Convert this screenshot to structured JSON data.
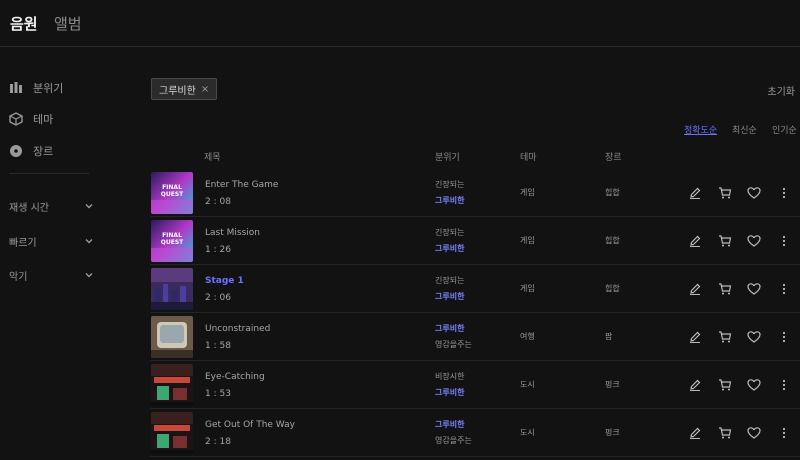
{
  "tabs": [
    {
      "label": "음원",
      "active": true
    },
    {
      "label": "앨범",
      "active": false
    }
  ],
  "sidebar": {
    "filters": [
      {
        "label": "분위기",
        "icon": "bars-icon"
      },
      {
        "label": "테마",
        "icon": "cube-icon"
      },
      {
        "label": "장르",
        "icon": "disc-icon"
      }
    ],
    "collapsibles": [
      {
        "label": "재생 시간",
        "icon": "chevron-down-icon"
      },
      {
        "label": "빠르기",
        "icon": "chevron-down-icon"
      },
      {
        "label": "악기",
        "icon": "chevron-down-icon"
      }
    ]
  },
  "active_filter": {
    "label": "그루비한",
    "remove": "×"
  },
  "reset_label": "초기화",
  "sort": {
    "options": [
      "정확도순",
      "최신순",
      "인기순"
    ],
    "selected": "정확도순"
  },
  "table": {
    "headers": {
      "title": "제목",
      "mood": "분위기",
      "theme": "테마",
      "genre": "장르"
    },
    "rows": [
      {
        "title": "Enter The Game",
        "duration": "2 : 08",
        "mood1": "긴장되는",
        "mood2": "그루비한",
        "accent": "mood2",
        "theme": "게임",
        "genre": "힙합",
        "art": "final-quest"
      },
      {
        "title": "Last Mission",
        "duration": "1 : 26",
        "mood1": "긴장되는",
        "mood2": "그루비한",
        "accent": "mood2",
        "theme": "게임",
        "genre": "힙합",
        "art": "final-quest"
      },
      {
        "title": "Stage 1",
        "duration": "2 : 06",
        "mood1": "긴장되는",
        "mood2": "그루비한",
        "accent": "mood2",
        "theme": "게임",
        "genre": "힙합",
        "art": "pixel-city",
        "highlight": true
      },
      {
        "title": "Unconstrained",
        "duration": "1 : 58",
        "mood1": "그루비한",
        "mood2": "영감을주는",
        "accent": "mood1",
        "theme": "여행",
        "genre": "팝",
        "art": "car-window"
      },
      {
        "title": "Eye-Catching",
        "duration": "1 : 53",
        "mood1": "비장시한",
        "mood2": "그루비한",
        "accent": "mood2",
        "theme": "도시",
        "genre": "펑크",
        "art": "street-neon"
      },
      {
        "title": "Get Out Of The Way",
        "duration": "2 : 18",
        "mood1": "그루비한",
        "mood2": "영감을주는",
        "accent": "mood1",
        "theme": "도시",
        "genre": "펑크",
        "art": "street-neon"
      }
    ],
    "actions": [
      "pencil-icon",
      "cart-icon",
      "heart-icon",
      "more-icon"
    ]
  },
  "colors": {
    "background": "#121212",
    "accent": "#6b72ff",
    "text": "#bdbdbd"
  }
}
